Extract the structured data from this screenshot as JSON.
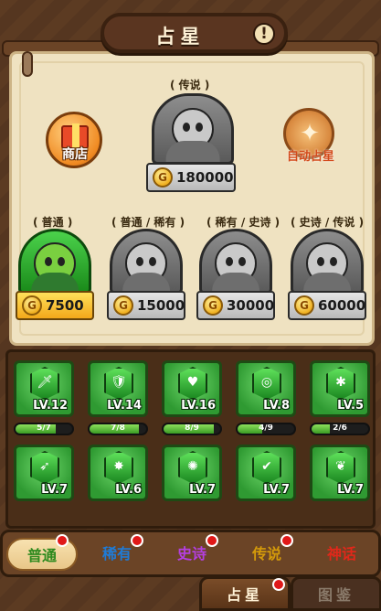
{
  "title": "占星",
  "info_icon": "!",
  "top": {
    "legend_label": "( 传说 )",
    "legend_price": "180000",
    "shop_label": "商店",
    "auto_label": "自动占星"
  },
  "heroes": [
    {
      "tier": "( 普通 )",
      "price": "7500",
      "style": "green"
    },
    {
      "tier": "( 普通 / 稀有 )",
      "price": "15000",
      "style": "gray"
    },
    {
      "tier": "( 稀有 / 史诗 )",
      "price": "30000",
      "style": "gray"
    },
    {
      "tier": "( 史诗 / 传说 )",
      "price": "60000",
      "style": "gray"
    }
  ],
  "coin_symbol": "G",
  "cards": [
    {
      "lv": "LV.12",
      "progress_text": "5/7",
      "progress": 0.71,
      "icon": "sword-icon",
      "glyph": "🗡"
    },
    {
      "lv": "LV.14",
      "progress_text": "7/8",
      "progress": 0.875,
      "icon": "shield-icon",
      "glyph": "🛡"
    },
    {
      "lv": "LV.16",
      "progress_text": "8/9",
      "progress": 0.89,
      "icon": "heart-icon",
      "glyph": "♥"
    },
    {
      "lv": "LV.8",
      "progress_text": "4/9",
      "progress": 0.44,
      "icon": "target-icon",
      "glyph": "◎"
    },
    {
      "lv": "LV.5",
      "progress_text": "2/6",
      "progress": 0.33,
      "icon": "puzzle-icon",
      "glyph": "✱"
    },
    {
      "lv": "LV.7",
      "progress_text": "",
      "progress": 0,
      "icon": "bow-icon",
      "glyph": "➶"
    },
    {
      "lv": "LV.6",
      "progress_text": "",
      "progress": 0,
      "icon": "flame-icon",
      "glyph": "✸"
    },
    {
      "lv": "LV.7",
      "progress_text": "",
      "progress": 0,
      "icon": "fire-burst-icon",
      "glyph": "✺"
    },
    {
      "lv": "LV.7",
      "progress_text": "",
      "progress": 0,
      "icon": "check-icon",
      "glyph": "✔"
    },
    {
      "lv": "LV.7",
      "progress_text": "",
      "progress": 0,
      "icon": "feather-icon",
      "glyph": "❦"
    }
  ],
  "tabs": [
    {
      "label": "普通",
      "color": "#2e8a1e",
      "active": true
    },
    {
      "label": "稀有",
      "color": "#1f7bd6",
      "active": false
    },
    {
      "label": "史诗",
      "color": "#b43fe0",
      "active": false
    },
    {
      "label": "传说",
      "color": "#d49a0a",
      "active": false
    },
    {
      "label": "神话",
      "color": "#e0281a",
      "active": false
    }
  ],
  "bottom_nav": [
    {
      "label": "占星",
      "active": true
    },
    {
      "label": "图鉴",
      "active": false
    }
  ]
}
